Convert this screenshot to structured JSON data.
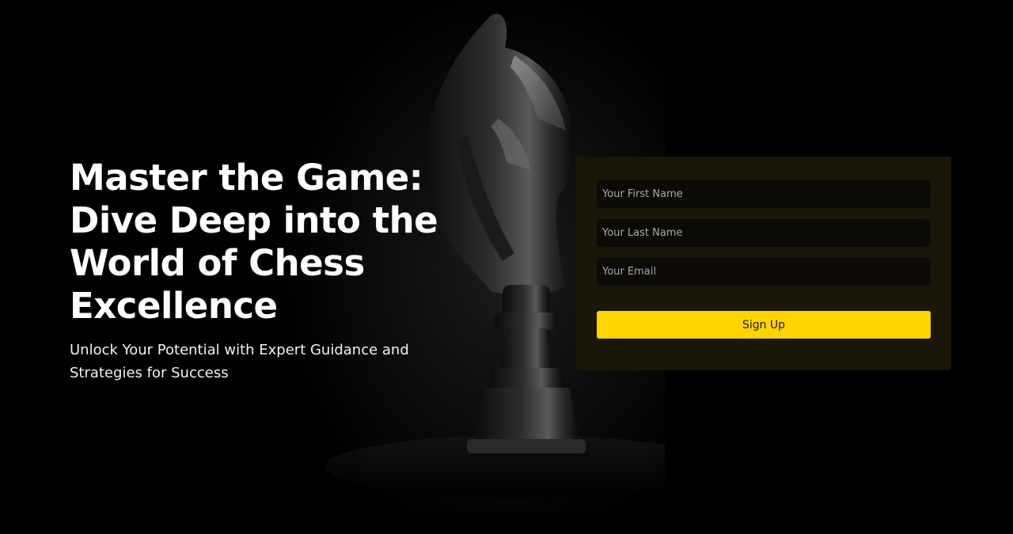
{
  "hero": {
    "headline": "Master the Game: Dive Deep into the World of Chess Excellence",
    "subtitle": "Unlock Your Potential with Expert Guidance and Strategies for Success"
  },
  "form": {
    "first_name_placeholder": "Your First Name",
    "last_name_placeholder": "Your Last Name",
    "email_placeholder": "Your Email",
    "submit_label": "Sign Up"
  },
  "colors": {
    "background": "#000000",
    "panel": "#1a1608",
    "accent": "#ffd400"
  },
  "icons": {
    "background_image": "chess-knight-icon"
  }
}
